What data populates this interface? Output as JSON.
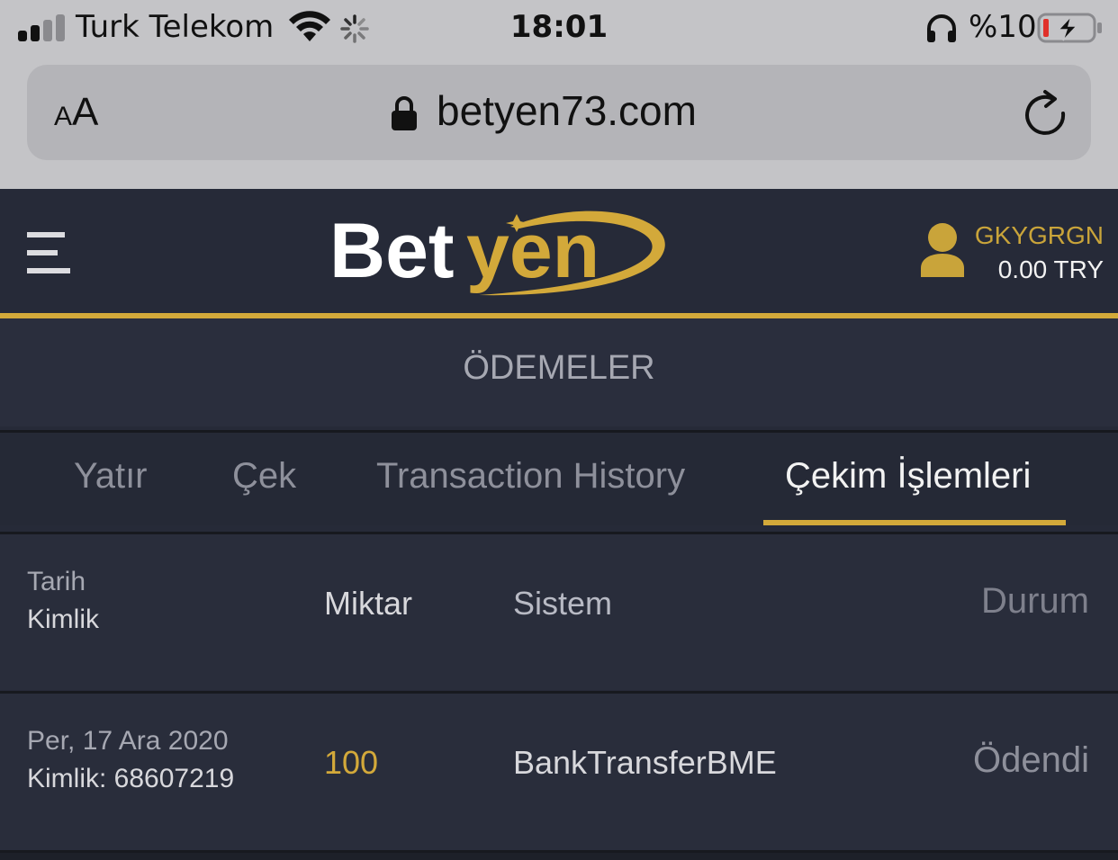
{
  "status_bar": {
    "carrier": "Turk Telekom",
    "time": "18:01",
    "battery_percent": "%10",
    "signal_bars_active": 2,
    "signal_bars_total": 4,
    "battery_level": 0.1,
    "icons": [
      "wifi-icon",
      "activity-spinner-icon",
      "headphones-icon",
      "battery-charging-icon"
    ]
  },
  "browser": {
    "text_size_label_small": "A",
    "text_size_label_big": "A",
    "url": "betyen73.com"
  },
  "header": {
    "logo_text_white": "Bet",
    "logo_text_gold": "yen",
    "username": "GKYGRGN",
    "balance": "0.00 TRY"
  },
  "page_title": "ÖDEMELER",
  "tabs": [
    {
      "label": "Yatır",
      "active": false
    },
    {
      "label": "Çek",
      "active": false
    },
    {
      "label": "Transaction History",
      "active": false
    },
    {
      "label": "Çekim İşlemleri",
      "active": true
    }
  ],
  "table": {
    "headers": {
      "tarih": "Tarih",
      "kimlik": "Kimlik",
      "miktar": "Miktar",
      "sistem": "Sistem",
      "durum": "Durum"
    },
    "rows": [
      {
        "date": "Per, 17 Ara 2020",
        "id": "Kimlik: 68607219",
        "amount": "100",
        "system": "BankTransferBME",
        "status": "Ödendi"
      }
    ]
  },
  "colors": {
    "accent_gold": "#d3a93a",
    "background": "#262a38",
    "browser_chrome": "#c4c4c7"
  }
}
